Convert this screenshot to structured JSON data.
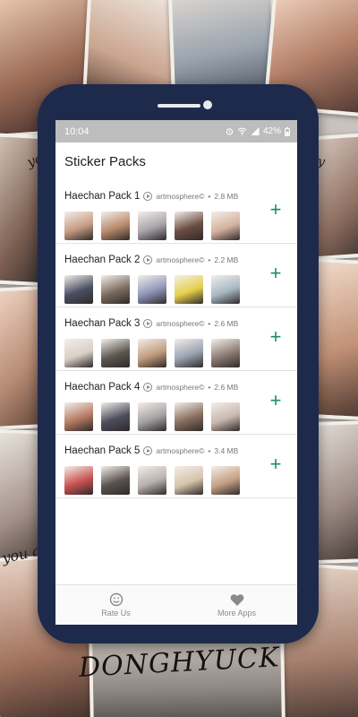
{
  "background": {
    "scribbles": [
      "you",
      "you ar",
      "DONGHYUCK",
      "by"
    ]
  },
  "statusbar": {
    "time": "10:04",
    "battery": "42%"
  },
  "app": {
    "title": "Sticker Packs"
  },
  "packs": [
    {
      "name": "Haechan Pack 1",
      "publisher": "artmosphere©",
      "size": "2.8 MB",
      "thumb_colors": [
        "#c79c83",
        "#b98a6a",
        "#a8a4a9",
        "#6b4e42",
        "#d3b29f"
      ]
    },
    {
      "name": "Haechan Pack 2",
      "publisher": "artmosphere©",
      "size": "2.2 MB",
      "thumb_colors": [
        "#4b4f63",
        "#7a6a5f",
        "#8f95b8",
        "#e6d04a",
        "#a7b9c4"
      ]
    },
    {
      "name": "Haechan Pack 3",
      "publisher": "artmosphere©",
      "size": "2.6 MB",
      "thumb_colors": [
        "#d9cfc6",
        "#5c5750",
        "#c19b7c",
        "#9aa3b1",
        "#8b7a73"
      ]
    },
    {
      "name": "Haechan Pack 4",
      "publisher": "artmosphere©",
      "size": "2.6 MB",
      "thumb_colors": [
        "#b67a63",
        "#4d4e5e",
        "#a6a2a4",
        "#8a6e5e",
        "#c8b7ae"
      ]
    },
    {
      "name": "Haechan Pack 5",
      "publisher": "artmosphere©",
      "size": "3.4 MB",
      "thumb_colors": [
        "#c8524f",
        "#5a524f",
        "#b7b0ad",
        "#d6c3ad",
        "#c4a084"
      ]
    }
  ],
  "nav": {
    "rate_label": "Rate Us",
    "rate_icon": "smiley-icon",
    "more_label": "More Apps",
    "more_icon": "heart-icon"
  },
  "colors": {
    "accent": "#1d8c6b",
    "phone_frame": "#1d2a4b",
    "statusbar_bg": "#bdbdbd"
  }
}
